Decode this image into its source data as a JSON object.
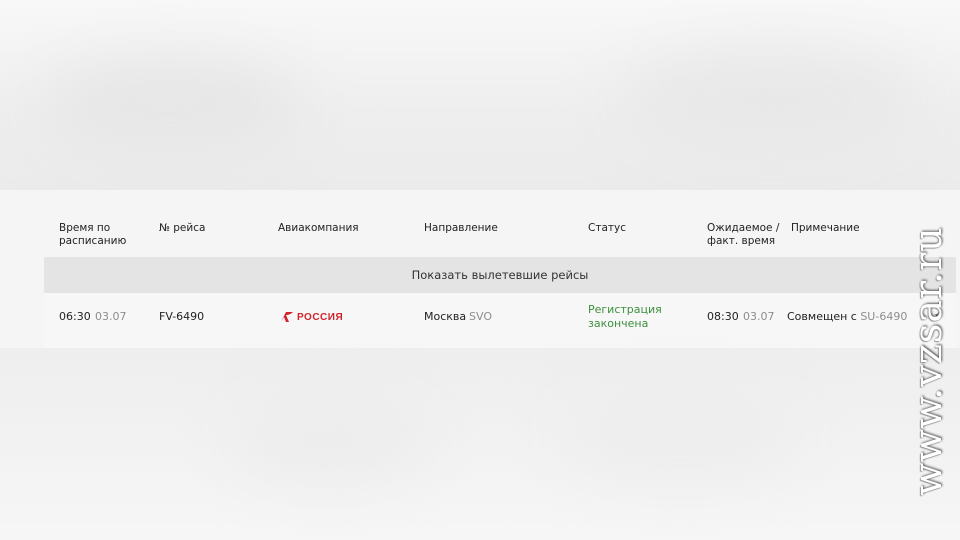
{
  "columns": {
    "scheduled": "Время по расписанию",
    "flight_no": "№ рейса",
    "airline": "Авиакомпания",
    "direction": "Направление",
    "status": "Статус",
    "expected": "Ожидаемое / факт. время",
    "note": "Примечание"
  },
  "show_departed_label": "Показать вылетевшие рейсы",
  "flights": [
    {
      "time": "06:30",
      "date": "03.07",
      "flight": "FV-6490",
      "airline_logo_text": "РОССИЯ",
      "city": "Москва",
      "airport": "SVO",
      "status": "Регистрация закончена",
      "expected_time": "08:30",
      "expected_date": "03.07",
      "note_prefix": "Совмещен с",
      "note_flight": "SU-6490"
    }
  ],
  "watermark": "www.vzsar.ru",
  "colors": {
    "status_green": "#3d8f3d",
    "brand_red": "#d0232b",
    "muted": "#8e8e8e"
  }
}
